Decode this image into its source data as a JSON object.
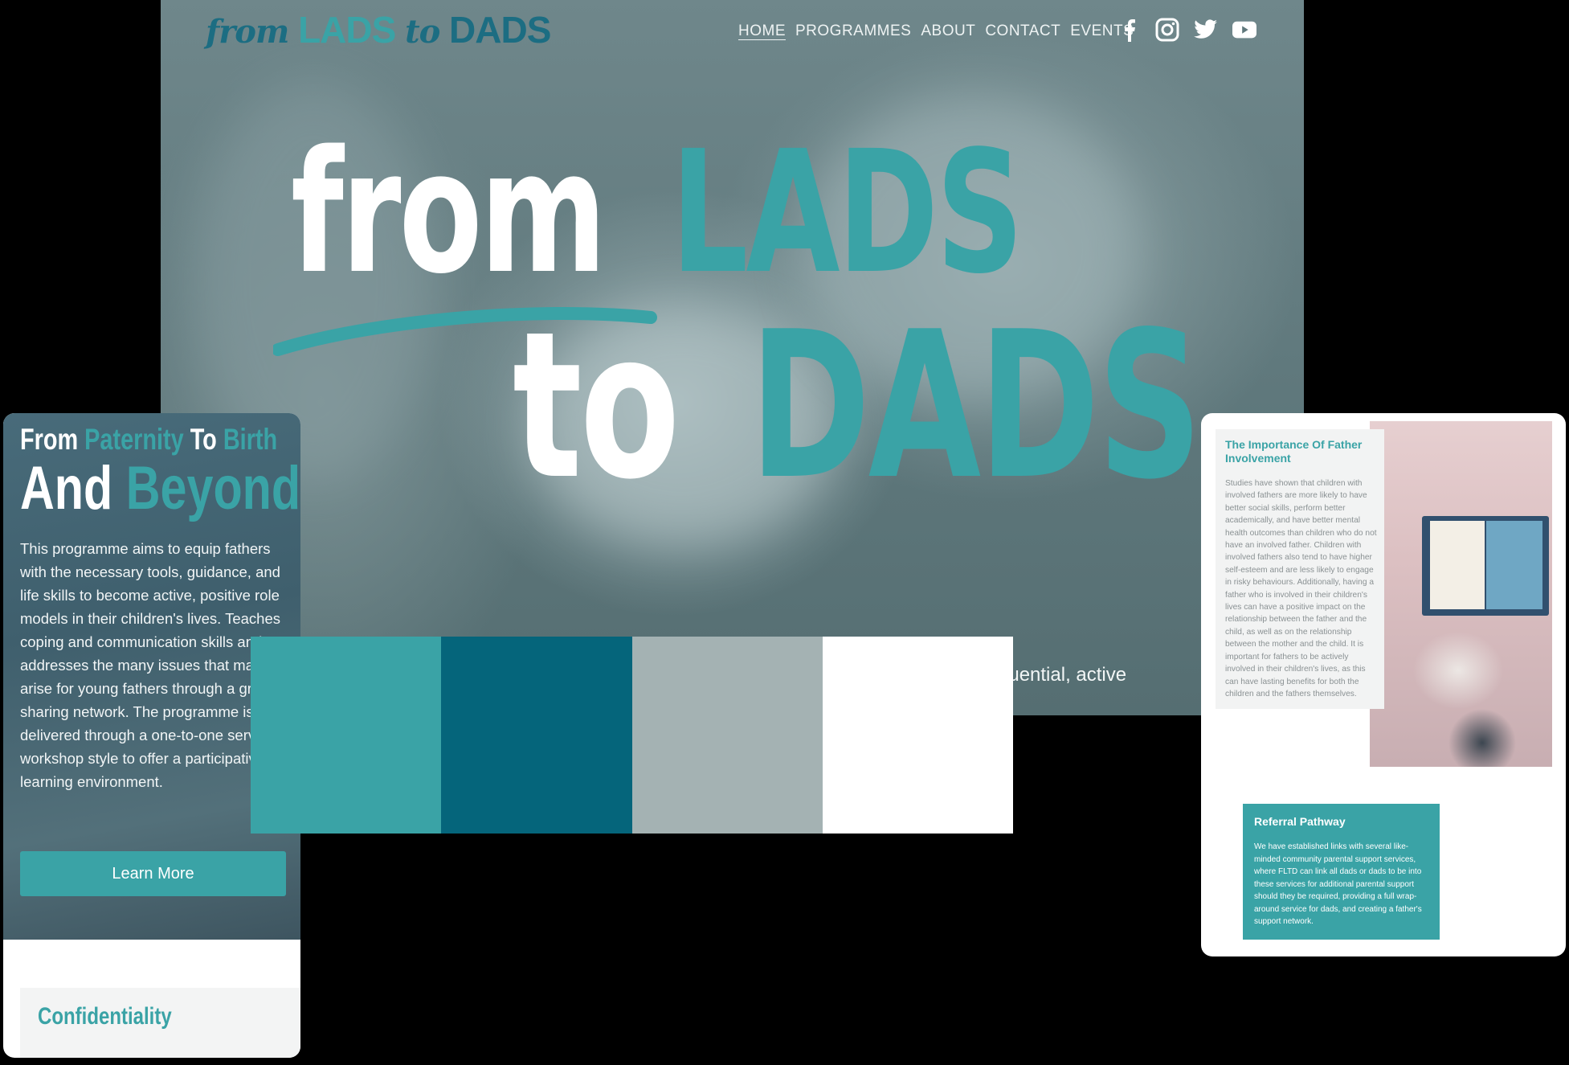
{
  "header": {
    "logo": {
      "from": "from",
      "lads": "LADS",
      "to": "to",
      "dads": "DADS"
    },
    "nav": [
      "HOME",
      "PROGRAMMES",
      "ABOUT",
      "CONTACT",
      "EVENTS"
    ],
    "social": [
      "facebook-icon",
      "instagram-icon",
      "twitter-icon",
      "youtube-icon"
    ]
  },
  "hero": {
    "word_from": "from",
    "word_lads": "LADS",
    "word_to": "to",
    "word_dads": "DADS",
    "tagline_fragment": "nfluential, active"
  },
  "mobile": {
    "heading_line1": {
      "a": "From ",
      "b": "Paternity",
      "c": " To ",
      "d": "Birth"
    },
    "heading_line2": {
      "a": "And ",
      "b": "Beyond"
    },
    "body": "This programme aims to equip fathers with the necessary tools, guidance, and life skills to become active, positive role models in their children's lives. Teaches coping and communication skills and addresses the many issues that may arise for young fathers through a group-sharing network. The programme is delivered through a one-to-one service or workshop style to offer a participative learning environment.",
    "button_label": "Learn More",
    "confidentiality_title": "Confidentiality"
  },
  "palette": {
    "colors": [
      "#3aa3a6",
      "#05657b",
      "#a4b2b3",
      "#ffffff"
    ]
  },
  "right_card": {
    "importance_title": "The Importance Of Father Involvement",
    "importance_text": "Studies have shown that children with involved fathers are more likely to have better social skills, perform better academically, and have better mental health outcomes than children who do not have an involved father. Children with involved fathers also tend to have higher self-esteem and are less likely to engage in risky behaviours. Additionally, having a father who is involved in their children's lives can have a positive impact on the relationship between the father and the child, as well as on the relationship between the mother and the child. It is important for fathers to be actively involved in their children's lives, as this can have lasting benefits for both the children and the fathers themselves.",
    "referral_title": "Referral Pathway",
    "referral_text": "We have established links with several like-minded community parental support services, where FLTD can link all dads or dads to be into these services for additional parental support should they be required, providing a full wrap-around service for dads, and creating a father's support network."
  },
  "colors": {
    "teal": "#3aa3a6",
    "dark_teal": "#05657b",
    "grey": "#a4b2b3",
    "white": "#ffffff"
  }
}
